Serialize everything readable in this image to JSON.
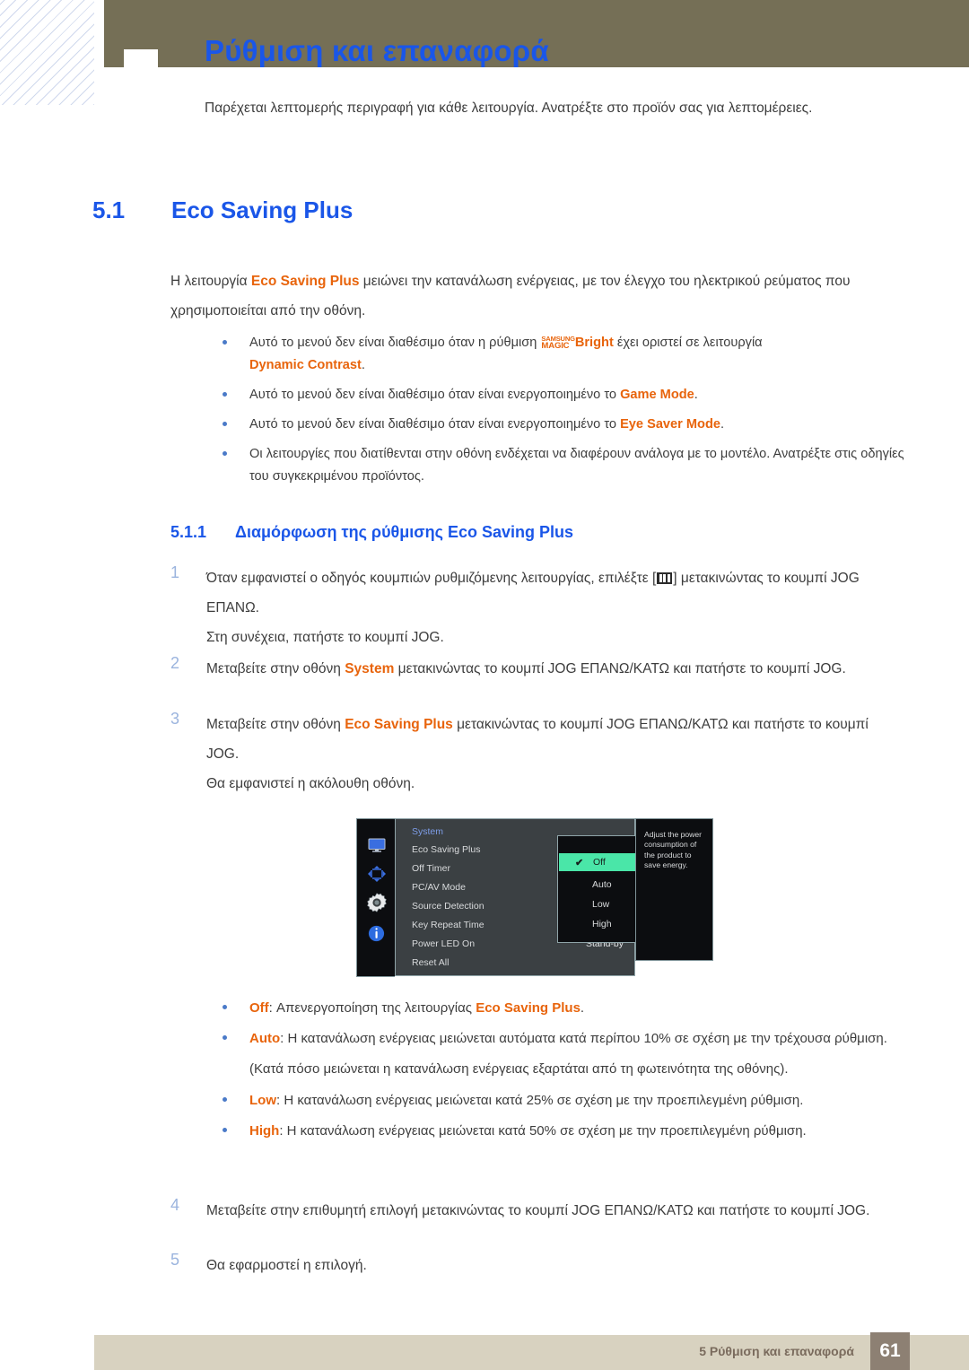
{
  "header": {
    "title": "Ρύθμιση και επαναφορά",
    "intro": "Παρέχεται λεπτομερής περιγραφή για κάθε λειτουργία. Ανατρέξτε στο προϊόν σας για λεπτομέρειες."
  },
  "section": {
    "number": "5.1",
    "title": "Eco Saving Plus",
    "body_before": "Η λειτουργία ",
    "body_bold": "Eco Saving Plus",
    "body_after": " μειώνει την κατανάλωση ενέργειας, με τον έλεγχο του ηλεκτρικού ρεύματος που χρησιμοποιείται από την οθόνη."
  },
  "notes": [
    {
      "pre": "Αυτό το μενού δεν είναι διαθέσιμο όταν η ρύθμιση ",
      "magic_l1": "SAMSUNG",
      "magic_l2": "MAGIC",
      "magic_word": "Bright",
      "mid": " έχει οριστεί σε λειτουργία ",
      "bold": "Dynamic Contrast",
      "post": "."
    },
    {
      "pre": "Αυτό το μενού δεν είναι διαθέσιμο όταν είναι ενεργοποιημένο το ",
      "bold": "Game Mode",
      "post": "."
    },
    {
      "pre": "Αυτό το μενού δεν είναι διαθέσιμο όταν είναι ενεργοποιημένο το ",
      "bold": "Eye Saver Mode",
      "post": "."
    },
    {
      "pre": "Οι λειτουργίες που διατίθενται στην οθόνη ενδέχεται να διαφέρουν ανάλογα με το μοντέλο. Ανατρέξτε στις οδηγίες του συγκεκριμένου προϊόντος.",
      "bold": "",
      "post": ""
    }
  ],
  "subsection": {
    "number": "5.1.1",
    "title": "Διαμόρφωση της ρύθμισης Eco Saving Plus"
  },
  "steps": [
    {
      "num": "1",
      "pre": "Όταν εμφανιστεί ο οδηγός κουμπιών ρυθμιζόμενης λειτουργίας, επιλέξτε [",
      "post": "] μετακινώντας το κουμπί JOG ΕΠΑΝΩ.",
      "extra": "Στη συνέχεια, πατήστε το κουμπί JOG.",
      "has_glyph": "yes"
    },
    {
      "num": "2",
      "pre": "Μεταβείτε στην οθόνη ",
      "bold": "System",
      "post": " μετακινώντας το κουμπί JOG ΕΠΑΝΩ/ΚΑΤΩ και πατήστε το κουμπί JOG.",
      "extra": ""
    },
    {
      "num": "3",
      "pre": "Μεταβείτε στην οθόνη ",
      "bold": "Eco Saving Plus",
      "post": " μετακινώντας το κουμπί JOG ΕΠΑΝΩ/ΚΑΤΩ και πατήστε το κουμπί JOG.",
      "extra": "Θα εμφανιστεί η ακόλουθη οθόνη."
    },
    {
      "num": "4",
      "pre": "Μεταβείτε στην επιθυμητή επιλογή μετακινώντας το κουμπί JOG ΕΠΑΝΩ/ΚΑΤΩ και πατήστε το κουμπί JOG.",
      "bold": "",
      "post": "",
      "extra": ""
    },
    {
      "num": "5",
      "pre": "Θα εφαρμοστεί η επιλογή.",
      "bold": "",
      "post": "",
      "extra": ""
    }
  ],
  "osd": {
    "icons": [
      {
        "name": "monitor-icon",
        "label": "monitor"
      },
      {
        "name": "directional-pad-icon",
        "label": "directional"
      },
      {
        "name": "gear-icon",
        "label": "gear"
      },
      {
        "name": "info-icon",
        "label": "info"
      }
    ],
    "menu_header": "System",
    "menu_items": [
      "Eco Saving Plus",
      "Off Timer",
      "PC/AV Mode",
      "Source Detection",
      "Key Repeat Time",
      "Power LED On",
      "Reset All"
    ],
    "power_led_value": "Stand-by",
    "submenu": {
      "options": [
        "Off",
        "Auto",
        "Low",
        "High"
      ],
      "selected": "Off",
      "check_glyph": "✔",
      "highlight_color": "#4ae6a8"
    },
    "help_text": "Adjust the power consumption of the product to save energy."
  },
  "options": [
    {
      "key": "Off",
      "pre": ": Απενεργοποίηση της λειτουργίας ",
      "bold": "Eco Saving Plus",
      "post": ".",
      "extra": ""
    },
    {
      "key": "Auto",
      "pre": ": Η κατανάλωση ενέργειας μειώνεται αυτόματα κατά περίπου 10% σε σχέση με την τρέχουσα ρύθμιση.",
      "bold": "",
      "post": "",
      "extra": "(Κατά πόσο μειώνεται η κατανάλωση ενέργειας εξαρτάται από τη φωτεινότητα της οθόνης)."
    },
    {
      "key": "Low",
      "pre": ": Η κατανάλωση ενέργειας μειώνεται κατά 25% σε σχέση με την προεπιλεγμένη ρύθμιση.",
      "bold": "",
      "post": "",
      "extra": ""
    },
    {
      "key": "High",
      "pre": ": Η κατανάλωση ενέργειας μειώνεται κατά 50% σε σχέση με την προεπιλεγμένη ρύθμιση.",
      "bold": "",
      "post": "",
      "extra": ""
    }
  ],
  "footer": {
    "text": "5 Ρύθμιση και επαναφορά",
    "page": "61"
  },
  "colors": {
    "heading_blue": "#1a56e8",
    "accent_orange": "#e8640c",
    "olive": "#756f56",
    "footer_beige": "#d8d2c0",
    "footer_page_box": "#8d8073",
    "osd_highlight": "#4ae6a8"
  }
}
